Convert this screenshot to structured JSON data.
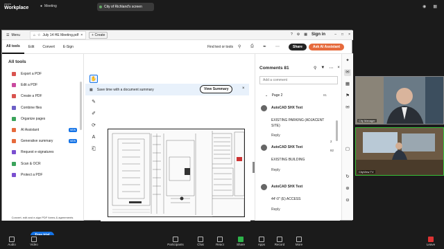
{
  "zoom": {
    "brand_line1": "zoom",
    "brand_line2": "Workplace",
    "meeting_label": "Meeting",
    "screen_share_title": "City of Richland's screen"
  },
  "acrobat": {
    "menu_label": "Menu",
    "doc_title": "July 14 HE Meeting.pdf",
    "create_label": "Create",
    "sign_in": "Sign in",
    "tabs": [
      "All tools",
      "Edit",
      "Convert",
      "E-Sign"
    ],
    "find": "Find text or tools",
    "share": "Share",
    "ask_ai": "Ask AI Assistant",
    "tools_heading": "All tools",
    "tools": [
      {
        "label": "Export a PDF",
        "color": "#d9534f",
        "new": false
      },
      {
        "label": "Edit a PDF",
        "color": "#c94a9f",
        "new": false
      },
      {
        "label": "Create a PDF",
        "color": "#d9534f",
        "new": false
      },
      {
        "label": "Combine files",
        "color": "#6c5fc7",
        "new": false
      },
      {
        "label": "Organize pages",
        "color": "#3aa35b",
        "new": false
      },
      {
        "label": "AI Assistant",
        "color": "#e66a3c",
        "new": true
      },
      {
        "label": "Generative summary",
        "color": "#e66a3c",
        "new": true
      },
      {
        "label": "Request e-signatures",
        "color": "#7a4fd0",
        "new": false
      },
      {
        "label": "Scan & OCR",
        "color": "#3aa35b",
        "new": false
      },
      {
        "label": "Protect a PDF",
        "color": "#7a4fd0",
        "new": false
      }
    ],
    "new_badge": "NEW",
    "promo": "Convert, edit and e-sign PDF forms & agreements",
    "free_trial": "Free trial",
    "banner_text": "Save time with a document summary",
    "view_summary": "View Summary",
    "comments_heading": "Comments",
    "comments_count": "81",
    "add_comment_placeholder": "Add a comment",
    "page_label": "Page 2",
    "page_count": "81",
    "comments": [
      {
        "author": "AutoCAD SHX Text",
        "text": "EXISTING PARKING (ADJACENT SITE)",
        "reply": "Reply"
      },
      {
        "author": "AutoCAD SHX Text",
        "text": "EXISTING BUILDING",
        "reply": "Reply"
      },
      {
        "author": "AutoCAD SHX Text",
        "text": "44'-0\" (E) ACCESS",
        "reply": "Reply"
      }
    ],
    "page_indicator_current": "2",
    "page_indicator_total": "82"
  },
  "videos": [
    {
      "label": "City Manager"
    },
    {
      "label": "CityView TV"
    }
  ],
  "bottombar": [
    {
      "label": "Audio"
    },
    {
      "label": "Video"
    },
    {
      "label": "Participants"
    },
    {
      "label": "Chat"
    },
    {
      "label": "React"
    },
    {
      "label": "Share"
    },
    {
      "label": "Apps"
    },
    {
      "label": "Record"
    },
    {
      "label": "More"
    },
    {
      "label": "Leave"
    }
  ]
}
